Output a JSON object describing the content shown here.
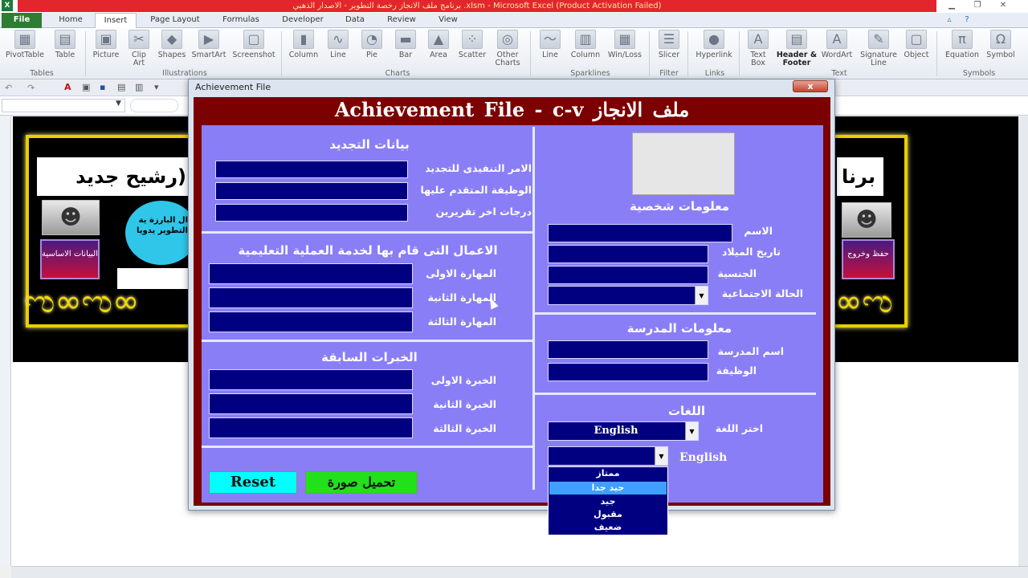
{
  "window": {
    "title": "برنامج ملف الانجاز رخصة التطوير - الاصدار الذهبي .xlsm - Microsoft Excel (Product Activation Failed)",
    "app_icon": "X"
  },
  "ribbon": {
    "tabs": [
      "File",
      "Home",
      "Insert",
      "Page Layout",
      "Formulas",
      "Developer",
      "Data",
      "Review",
      "View"
    ],
    "buttons": [
      "PivotTable",
      "Table",
      "Picture",
      "Clip Art",
      "Shapes",
      "SmartArt",
      "Screenshot",
      "Column",
      "Line",
      "Pie",
      "Bar",
      "Area",
      "Scatter",
      "Other Charts",
      "Line",
      "Column",
      "Win/Loss",
      "Slicer",
      "Hyperlink",
      "Text Box",
      "Header & Footer",
      "WordArt",
      "Signature Line",
      "Object",
      "Equation",
      "Symbol"
    ],
    "groups": [
      "Tables",
      "Illustrations",
      "Charts",
      "Sparklines",
      "Filter",
      "Links",
      "Text",
      "Symbols"
    ]
  },
  "banner": {
    "title_left": "رشيح جديد)",
    "title_right": "برنا",
    "oval_text": "ال البارزة ية التطوير يدويا",
    "btn_basic": "البيانات الاساسية",
    "btn_save": "حفظ وخروج"
  },
  "dialog": {
    "window_title": "Achievement File",
    "close": "x",
    "header": "Achievement File - c-v ملف الانجاز",
    "renewal": {
      "title": "بيانات التجديد",
      "fields": [
        "الامر التنفيذى للتجديد",
        "الوظيفة المتقدم عليها",
        "درجات اخر تقريرين"
      ]
    },
    "works": {
      "title": "الاعمال التى قام بها لخدمة العملية التعليمية",
      "fields": [
        "المهارة الاولى",
        "المهارة الثانية",
        "المهارة الثالثة"
      ]
    },
    "experience": {
      "title": "الخبرات السابقة",
      "fields": [
        "الخبرة الاولى",
        "الخبرة الثانية",
        "الخبرة الثالثة"
      ]
    },
    "personal": {
      "title": "معلومات شخصية",
      "fields": [
        "الاسم",
        "تاريخ الميلاد",
        "الجنسية",
        "الحالة الاجتماعية"
      ]
    },
    "school": {
      "title": "معلومات المدرسة",
      "fields": [
        "اسم المدرسة",
        "الوظيفة"
      ]
    },
    "languages": {
      "title": "اللغات",
      "choose_label": "اختر اللغة",
      "selected_language": "English",
      "level_label": "English",
      "levels": [
        "ممتاز",
        "جيد جدا",
        "جيد",
        "مقبول",
        "ضعيف"
      ],
      "highlighted_level": "جيد جدا"
    },
    "buttons": {
      "reset": "Reset",
      "upload_photo": "تحميل صورة"
    }
  },
  "colors": {
    "panel": "#8a7ef7",
    "frame": "#7b0000",
    "field": "#000080",
    "reset_bg": "#00ffff",
    "upload_bg": "#22e01a",
    "dropdown_highlight": "#3fa0ff"
  }
}
